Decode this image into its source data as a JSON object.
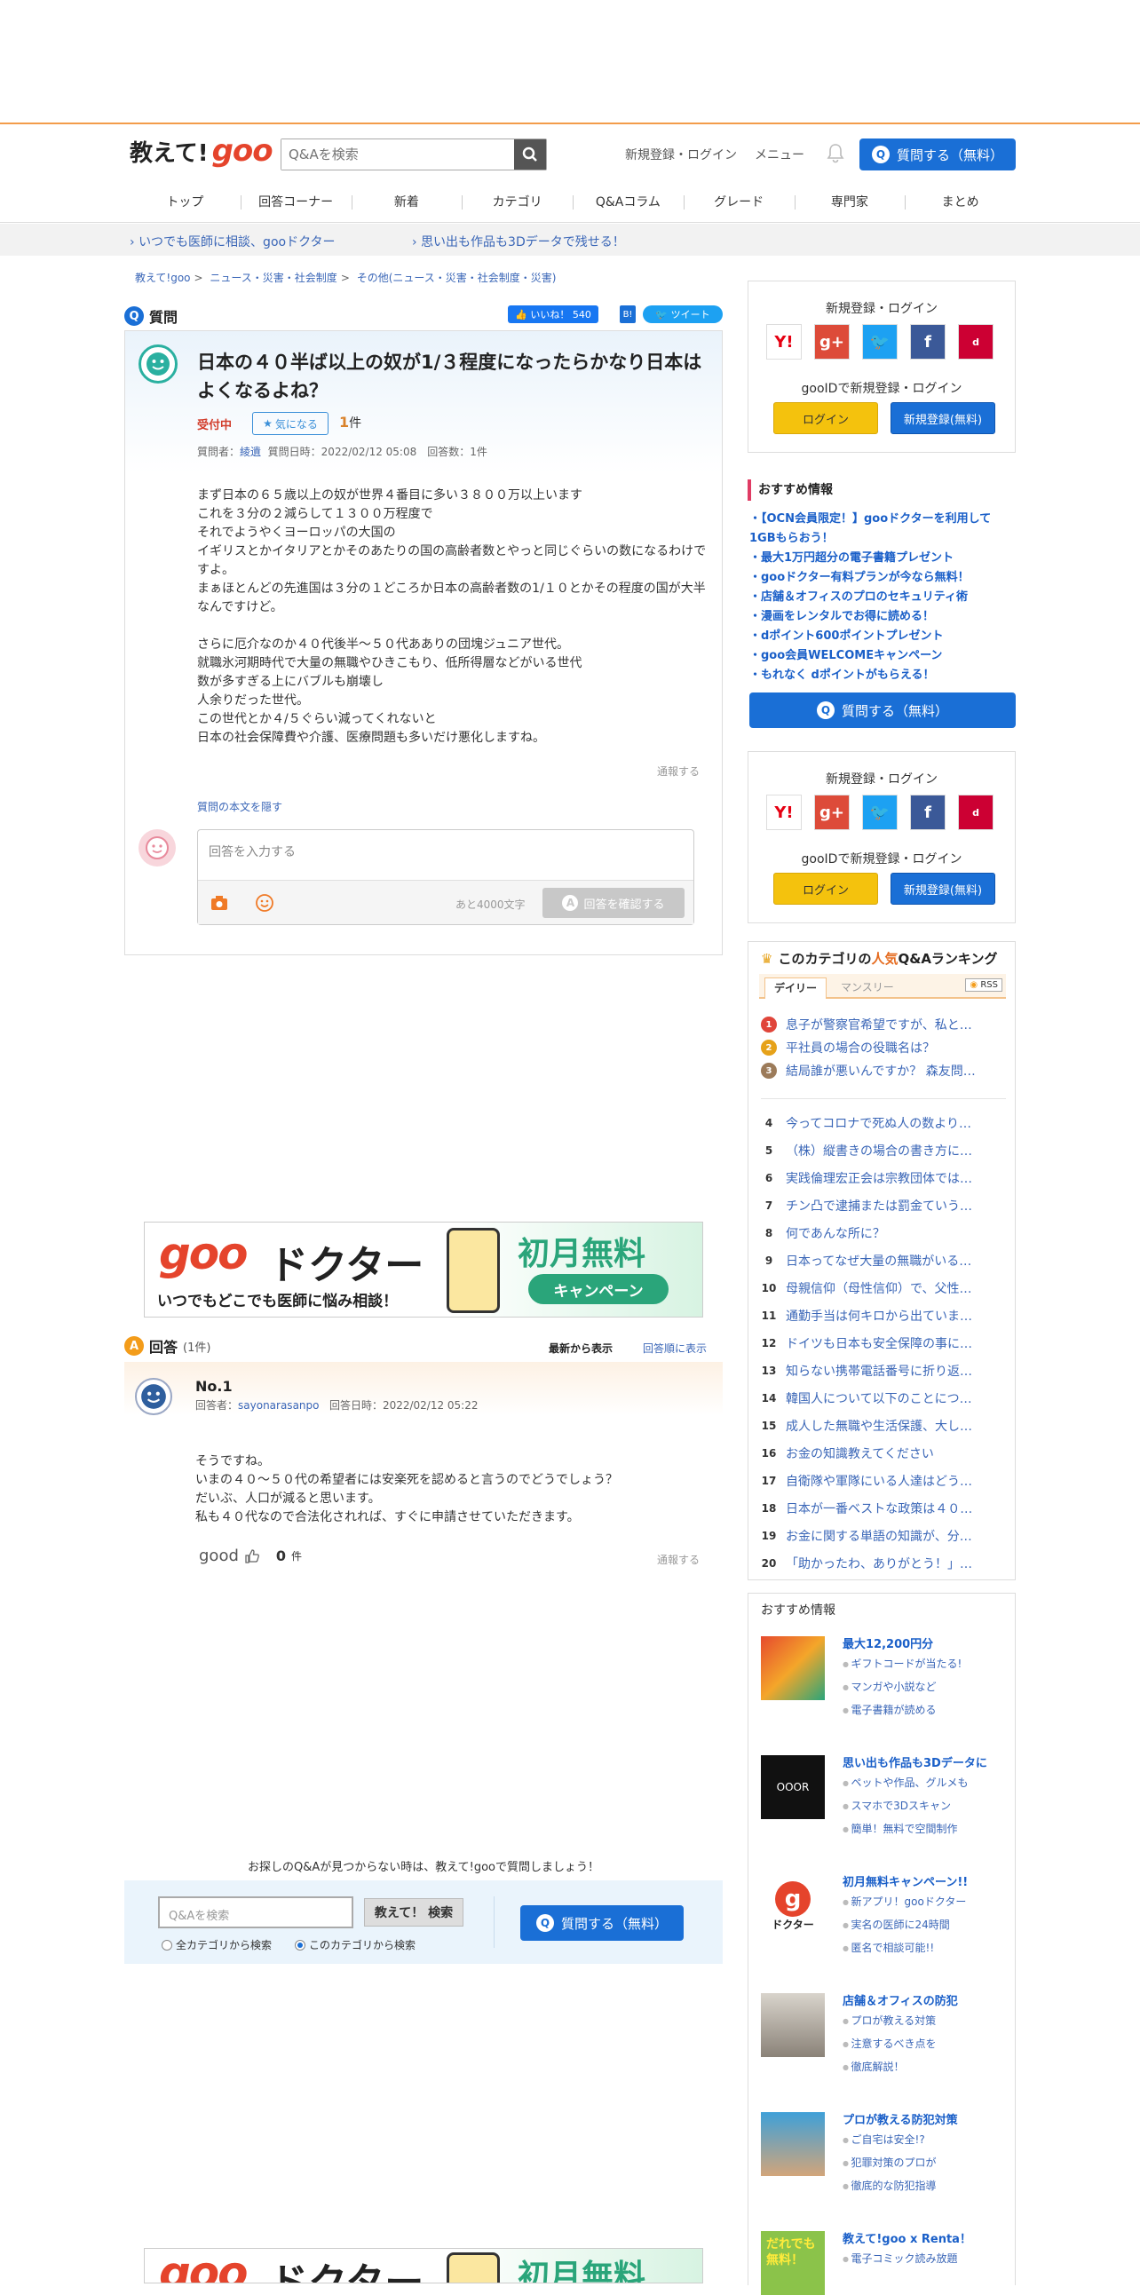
{
  "header": {
    "logo_text": "教えて!",
    "logo_goo": "goo",
    "search_placeholder": "Q&Aを検索",
    "register_login": "新規登録・ログイン",
    "menu": "メニュー",
    "ask_button": "質問する（無料）"
  },
  "nav": [
    "トップ",
    "回答コーナー",
    "新着",
    "カテゴリ",
    "Q&Aコラム",
    "グレード",
    "専門家",
    "まとめ"
  ],
  "promo": [
    "いつでも医師に相談、gooドクター",
    "思い出も作品も3Dデータで残せる！"
  ],
  "breadcrumb": [
    "教えて!goo",
    "ニュース・災害・社会制度",
    "その他(ニュース・災害・社会制度・災害)"
  ],
  "question": {
    "section_label": "質問",
    "like_label": "いいね！ 540",
    "tweet_label": "ツイート",
    "title": "日本の４０半ば以上の奴が1/３程度になったらかなり日本はよくなるよね？",
    "status": "受付中",
    "kininaru": "気になる",
    "kininaru_count": "1",
    "kininaru_unit": "件",
    "meta_prefix": "質問者：",
    "asker": "綾遺",
    "meta_rest": "質問日時：2022/02/12 05:08　回答数：1件",
    "body": "まず日本の６５歳以上の奴が世界４番目に多い３８００万以上います\nこれを３分の２減らして１３００万程度で\nそれでようやくヨーロッパの大国の\nイギリスとかイタリアとかそのあたりの国の高齢者数とやっと同じぐらいの数になるわけですよ。\nまぁほとんどの先進国は３分の１どころか日本の高齢者数の1/１０とかその程度の国が大半なんですけど。\n\nさらに厄介なのか４０代後半～５０代あありの団塊ジュニア世代。\n就職氷河期時代で大量の無職やひきこもり、低所得層などがいる世代\n数が多すぎる上にバブルも崩壊し\n人余りだった世代。\nこの世代とか４/５ぐらい減ってくれないと\n日本の社会保障費や介護、医療問題も多いだけ悪化しますね。",
    "report": "通報する",
    "hide_link": "質問の本文を隠す",
    "answer_placeholder": "回答を入力する",
    "remaining": "あと4000文字",
    "confirm_button": "回答を確認する"
  },
  "banner": {
    "goo": "goo",
    "doctor": "ドクター",
    "sub": "いつでもどこでも医師に悩み相談！",
    "free": "初月無料",
    "campaign": "キャンペーン"
  },
  "answers": {
    "section_label": "回答",
    "count": "(1件)",
    "sort_new": "最新から表示",
    "sort_old": "回答順に表示",
    "items": [
      {
        "no": "No.1",
        "answerer_prefix": "回答者：",
        "answerer": "sayonarasanpo",
        "date": "回答日時：2022/02/12 05:22",
        "body": "そうですね。\nいまの４０～５０代の希望者には安楽死を認めると言うのでどうでしょう？\nだいぶ、人口が減ると思います。\n私も４０代なので合法化されれば、すぐに申請させていただきます。",
        "good_label": "good",
        "good_count": "0",
        "good_unit": "件",
        "report": "通報する"
      }
    ]
  },
  "bottom_search": {
    "message": "お探しのQ&Aが見つからない時は、教えて!gooで質問しましょう！",
    "placeholder": "Q&Aを検索",
    "search_button": "教えて！ 検索",
    "radio_all": "全カテゴリから検索",
    "radio_this": "このカテゴリから検索",
    "ask_button": "質問する（無料）"
  },
  "sidebar": {
    "login_title": "新規登録・ログイン",
    "gooid": "gooIDで新規登録・ログイン",
    "login_button": "ログイン",
    "register_button": "新規登録(無料)",
    "rec_title": "おすすめ情報",
    "rec_items": [
      "・【OCN会員限定！】gooドクターを利用して1GBもらおう！",
      "・最大1万円超分の電子書籍プレゼント",
      "・gooドクター有料プランが今なら無料！",
      "・店舗＆オフィスのプロのセキュリティ術",
      "・漫画をレンタルでお得に読める！",
      "・dポイント600ポイントプレゼント",
      "・goo会員WELCOMEキャンペーン",
      "・もれなく dポイントがもらえる！"
    ],
    "ask_button": "質問する（無料）",
    "ranking_title_pre": "このカテゴリの",
    "ranking_title_pop": "人気",
    "ranking_title_post": "Q&Aランキング",
    "tab_daily": "デイリー",
    "tab_monthly": "マンスリー",
    "rss": "RSS",
    "ranking": [
      "息子が警察官希望ですが、私と…",
      "平社員の場合の役職名は？",
      "結局誰が悪いんですか？ 森友問…",
      "今ってコロナで死ぬ人の数より…",
      "（株）縦書きの場合の書き方に…",
      "実践倫理宏正会は宗教団体では…",
      "チン凸で逮捕または罰金ていう…",
      "何であんな所に？",
      "日本ってなぜ大量の無職がいる…",
      "母親信仰（母性信仰）で、父性…",
      "通勤手当は何キロから出ていま…",
      "ドイツも日本も安全保障の事に…",
      "知らない携帯電話番号に折り返…",
      "韓国人について以下のことにつ…",
      "成人した無職や生活保護、大し…",
      "お金の知識教えてください",
      "自衛隊や軍隊にいる人達はどう…",
      "日本が一番ベストな政策は４０…",
      "お金に関する単語の知識が、分…",
      "「助かったわ、ありがとう！」…"
    ],
    "osusume_title": "おすすめ情報",
    "osusume": [
      {
        "head": "最大12,200円分",
        "items": [
          "ギフトコードが当たる!",
          "マンガや小説など",
          "電子書籍が読める"
        ]
      },
      {
        "head": "思い出も作品も3Dデータに",
        "items": [
          "ペットや作品、グルメも",
          "スマホで3Dスキャン",
          "簡単！無料で空間制作"
        ]
      },
      {
        "head": "初月無料キャンペーン!!",
        "items": [
          "新アプリ！gooドクター",
          "実名の医師に24時間",
          "匿名で相談可能!!"
        ]
      },
      {
        "head": "店舗＆オフィスの防犯",
        "items": [
          "プロが教える対策",
          "注意するべき点を",
          "徹底解説！"
        ]
      },
      {
        "head": "プロが教える防犯対策",
        "items": [
          "ご自宅は安全!?",
          "犯罪対策のプロが",
          "徹底的な防犯指導"
        ]
      },
      {
        "head": "教えて!goo x Renta！",
        "items": [
          "電子コミック読み放題"
        ]
      }
    ],
    "ooor_label": "OOOR",
    "doctor_label": "ドクター",
    "daredemo": "だれでも無料！"
  },
  "colors": {
    "accent": "#1a6fd6",
    "brand": "#e5442c",
    "topline": "#f39c4a"
  }
}
